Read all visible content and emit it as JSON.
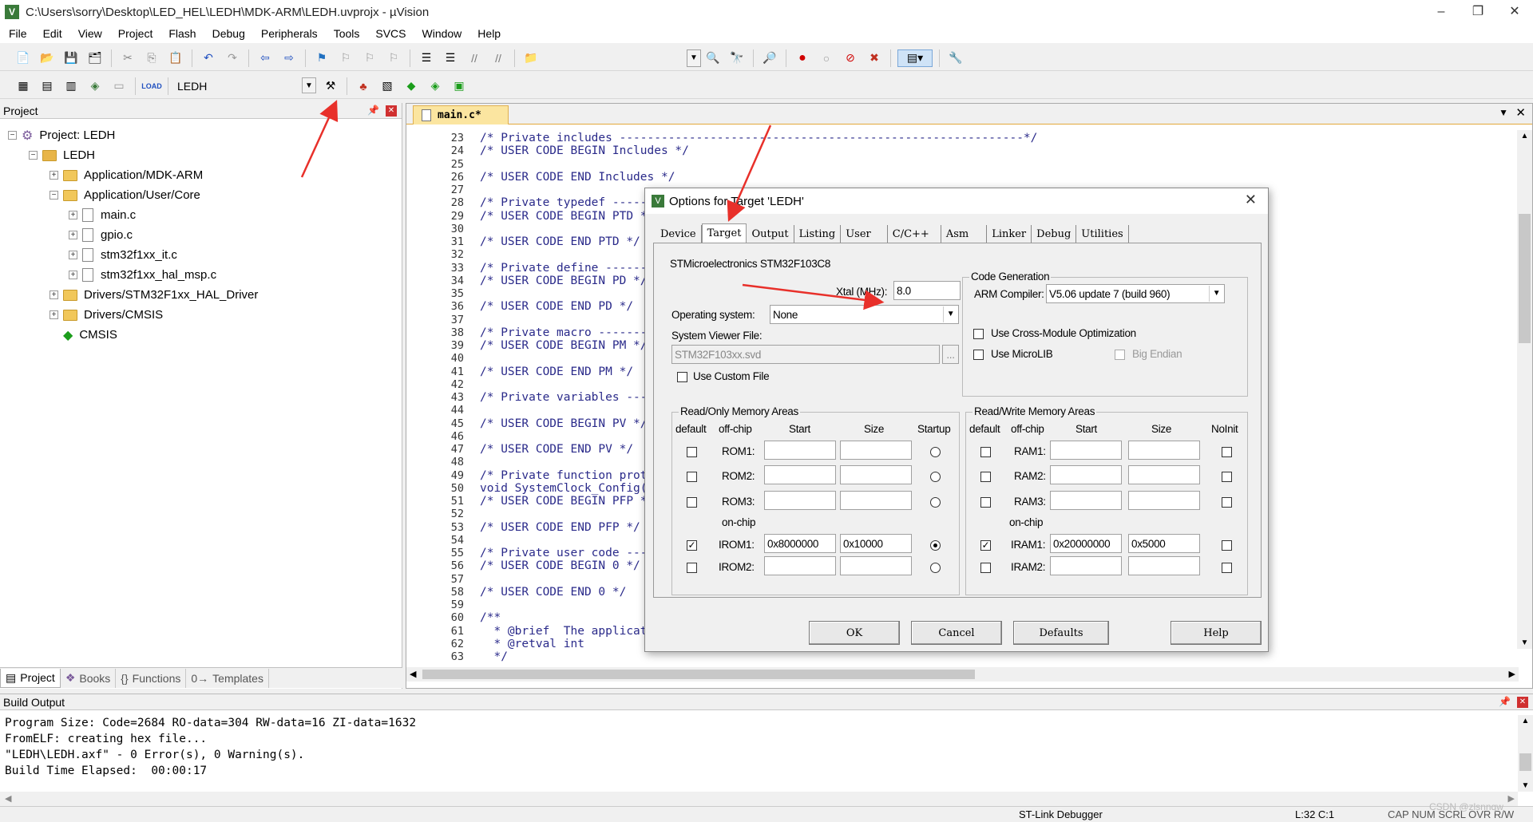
{
  "window": {
    "title": "C:\\Users\\sorry\\Desktop\\LED_HEL\\LEDH\\MDK-ARM\\LEDH.uvprojx - µVision",
    "app_icon": "V",
    "controls": {
      "minimize": "–",
      "maximize": "❐",
      "close": "✕"
    }
  },
  "menu": [
    "File",
    "Edit",
    "View",
    "Project",
    "Flash",
    "Debug",
    "Peripherals",
    "Tools",
    "SVCS",
    "Window",
    "Help"
  ],
  "toolbar2": {
    "target_combo": "LEDH",
    "load_label": "LOAD"
  },
  "project_panel": {
    "header": "Project",
    "tree": [
      {
        "label": "Project: LEDH",
        "level": 0,
        "icon": "project-icon"
      },
      {
        "label": "LEDH",
        "level": 1,
        "icon": "target-icon"
      },
      {
        "label": "Application/MDK-ARM",
        "level": 2,
        "icon": "folder-icon"
      },
      {
        "label": "Application/User/Core",
        "level": 2,
        "icon": "folder-icon"
      },
      {
        "label": "main.c",
        "level": 3,
        "icon": "file-icon"
      },
      {
        "label": "gpio.c",
        "level": 3,
        "icon": "file-icon"
      },
      {
        "label": "stm32f1xx_it.c",
        "level": 3,
        "icon": "file-icon"
      },
      {
        "label": "stm32f1xx_hal_msp.c",
        "level": 3,
        "icon": "file-icon"
      },
      {
        "label": "Drivers/STM32F1xx_HAL_Driver",
        "level": 2,
        "icon": "folder-icon"
      },
      {
        "label": "Drivers/CMSIS",
        "level": 2,
        "icon": "folder-icon"
      },
      {
        "label": "CMSIS",
        "level": 2,
        "icon": "gem-icon"
      }
    ],
    "tabs": [
      "Project",
      "Books",
      "Functions",
      "Templates"
    ]
  },
  "editor": {
    "tab": "main.c*",
    "lines": [
      {
        "n": "23",
        "t": "/* Private includes ----------------------------------------------------------*/"
      },
      {
        "n": "24",
        "t": "/* USER CODE BEGIN Includes */"
      },
      {
        "n": "25",
        "t": ""
      },
      {
        "n": "26",
        "t": "/* USER CODE END Includes */"
      },
      {
        "n": "27",
        "t": ""
      },
      {
        "n": "28",
        "t": "/* Private typedef -----"
      },
      {
        "n": "29",
        "t": "/* USER CODE BEGIN PTD *"
      },
      {
        "n": "30",
        "t": ""
      },
      {
        "n": "31",
        "t": "/* USER CODE END PTD */"
      },
      {
        "n": "32",
        "t": ""
      },
      {
        "n": "33",
        "t": "/* Private define ------"
      },
      {
        "n": "34",
        "t": "/* USER CODE BEGIN PD */"
      },
      {
        "n": "35",
        "t": ""
      },
      {
        "n": "36",
        "t": "/* USER CODE END PD */"
      },
      {
        "n": "37",
        "t": ""
      },
      {
        "n": "38",
        "t": "/* Private macro -------"
      },
      {
        "n": "39",
        "t": "/* USER CODE BEGIN PM */"
      },
      {
        "n": "40",
        "t": ""
      },
      {
        "n": "41",
        "t": "/* USER CODE END PM */"
      },
      {
        "n": "42",
        "t": ""
      },
      {
        "n": "43",
        "t": "/* Private variables ---"
      },
      {
        "n": "44",
        "t": ""
      },
      {
        "n": "45",
        "t": "/* USER CODE BEGIN PV */"
      },
      {
        "n": "46",
        "t": ""
      },
      {
        "n": "47",
        "t": "/* USER CODE END PV */"
      },
      {
        "n": "48",
        "t": ""
      },
      {
        "n": "49",
        "t": "/* Private function prot"
      },
      {
        "n": "50",
        "t": "void SystemClock_Config("
      },
      {
        "n": "51",
        "t": "/* USER CODE BEGIN PFP *"
      },
      {
        "n": "52",
        "t": ""
      },
      {
        "n": "53",
        "t": "/* USER CODE END PFP */"
      },
      {
        "n": "54",
        "t": ""
      },
      {
        "n": "55",
        "t": "/* Private user code ---"
      },
      {
        "n": "56",
        "t": "/* USER CODE BEGIN 0 */"
      },
      {
        "n": "57",
        "t": ""
      },
      {
        "n": "58",
        "t": "/* USER CODE END 0 */"
      },
      {
        "n": "59",
        "t": ""
      },
      {
        "n": "60",
        "t": "/**"
      },
      {
        "n": "61",
        "t": "  * @brief  The applicat"
      },
      {
        "n": "62",
        "t": "  * @retval int"
      },
      {
        "n": "63",
        "t": "  */"
      }
    ]
  },
  "dialog": {
    "title": "Options for Target 'LEDH'",
    "close": "✕",
    "tabs": [
      "Device",
      "Target",
      "Output",
      "Listing",
      "User",
      "C/C++",
      "Asm",
      "Linker",
      "Debug",
      "Utilities"
    ],
    "active_tab": "Target",
    "device_name": "STMicroelectronics STM32F103C8",
    "xtal_label": "Xtal (MHz):",
    "xtal_value": "8.0",
    "os_label": "Operating system:",
    "os_value": "None",
    "svf_label": "System Viewer File:",
    "svf_value": "STM32F103xx.svd",
    "browse": "...",
    "use_custom_file": "Use Custom File",
    "code_gen": {
      "title": "Code Generation",
      "compiler_label": "ARM Compiler:",
      "compiler_value": "V5.06 update 7 (build 960)",
      "cross_module": "Use Cross-Module Optimization",
      "microlib": "Use MicroLIB",
      "big_endian": "Big Endian"
    },
    "ro_mem": {
      "title": "Read/Only Memory Areas",
      "headers": {
        "default": "default",
        "offchip": "off-chip",
        "start": "Start",
        "size": "Size",
        "startup": "Startup"
      },
      "onchip": "on-chip",
      "rows": [
        {
          "name": "ROM1:",
          "start": "",
          "size": "",
          "checked": false,
          "startup": false
        },
        {
          "name": "ROM2:",
          "start": "",
          "size": "",
          "checked": false,
          "startup": false
        },
        {
          "name": "ROM3:",
          "start": "",
          "size": "",
          "checked": false,
          "startup": false
        },
        {
          "name": "IROM1:",
          "start": "0x8000000",
          "size": "0x10000",
          "checked": true,
          "startup": true
        },
        {
          "name": "IROM2:",
          "start": "",
          "size": "",
          "checked": false,
          "startup": false
        }
      ]
    },
    "rw_mem": {
      "title": "Read/Write Memory Areas",
      "headers": {
        "default": "default",
        "offchip": "off-chip",
        "start": "Start",
        "size": "Size",
        "noinit": "NoInit"
      },
      "onchip": "on-chip",
      "rows": [
        {
          "name": "RAM1:",
          "start": "",
          "size": "",
          "checked": false
        },
        {
          "name": "RAM2:",
          "start": "",
          "size": "",
          "checked": false
        },
        {
          "name": "RAM3:",
          "start": "",
          "size": "",
          "checked": false
        },
        {
          "name": "IRAM1:",
          "start": "0x20000000",
          "size": "0x5000",
          "checked": true
        },
        {
          "name": "IRAM2:",
          "start": "",
          "size": "",
          "checked": false
        }
      ]
    },
    "buttons": {
      "ok": "OK",
      "cancel": "Cancel",
      "defaults": "Defaults",
      "help": "Help"
    }
  },
  "build_output": {
    "header": "Build Output",
    "lines": [
      "Program Size: Code=2684 RO-data=304 RW-data=16 ZI-data=1632",
      "FromELF: creating hex file...",
      "\"LEDH\\LEDH.axf\" - 0 Error(s), 0 Warning(s).",
      "Build Time Elapsed:  00:00:17"
    ]
  },
  "status": {
    "debugger": "ST-Link Debugger",
    "position": "L:32 C:1",
    "keys": "CAP  NUM  SCRL  OVR  R/W",
    "watermark": "CSDN @zlsnnqw"
  },
  "colors": {
    "annotation_arrow": "#e8302a",
    "tab_active": "#fbe5a0",
    "comment": "#2a2a8a"
  }
}
